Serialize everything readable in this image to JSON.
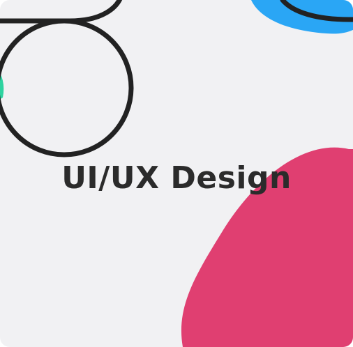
{
  "card": {
    "title": "UI/UX Design"
  },
  "colors": {
    "background": "#f1f1f3",
    "outline": "#222222",
    "accent_blue": "#2aa6f5",
    "accent_pink": "#e03f71",
    "accent_green": "#2ed3a0",
    "text": "#2b2b2b"
  },
  "decorations": {
    "ring": "ring-outline-shape",
    "top_loop": "loop-outline-shape",
    "blob_blue": "blue-blob-shape",
    "blob_pink": "pink-blob-shape",
    "accent_green": "green-accent-shape"
  }
}
